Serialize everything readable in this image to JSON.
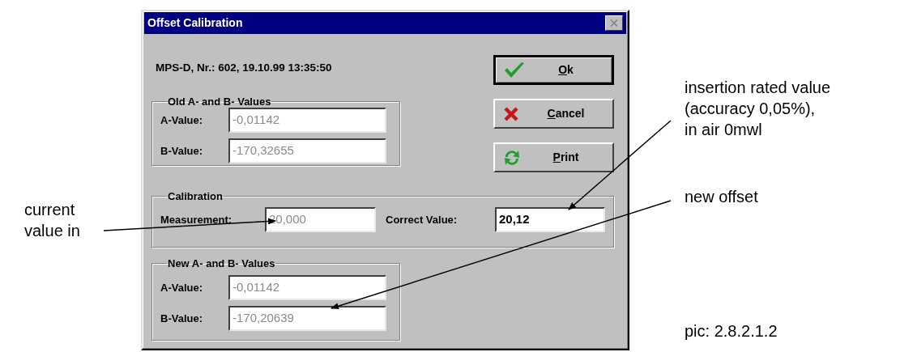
{
  "dialog": {
    "title": "Offset Calibration",
    "header": "MPS-D, Nr.: 602, 19.10.99 13:35:50",
    "groups": [
      {
        "title": "Old A- and B- Values",
        "fields": [
          {
            "label": "A-Value:",
            "value": "-0,01142",
            "disabled": true
          },
          {
            "label": "B-Value:",
            "value": "-170,32655",
            "disabled": true
          }
        ]
      },
      {
        "title": "Calibration",
        "fields": [
          {
            "label": "Measurement:",
            "value": "20,000",
            "disabled": true
          },
          {
            "label": "Correct Value:",
            "value": "20,12",
            "disabled": false
          }
        ]
      },
      {
        "title": "New A- and B- Values",
        "fields": [
          {
            "label": "A-Value:",
            "value": "-0,01142",
            "disabled": true
          },
          {
            "label": "B-Value:",
            "value": "-170,20639",
            "disabled": true
          }
        ]
      }
    ],
    "buttons": [
      {
        "label": "Ok",
        "kind": "check",
        "default": true
      },
      {
        "label": "Cancel",
        "kind": "cross",
        "default": false
      },
      {
        "label": "Print",
        "kind": "refresh",
        "default": false
      }
    ]
  },
  "annotations": [
    {
      "lines": [
        "current",
        "value in"
      ]
    },
    {
      "lines": [
        "insertion rated value",
        "(accuracy 0,05%),",
        "in air 0mwl"
      ]
    },
    {
      "lines": [
        "new offset"
      ]
    }
  ],
  "caption": "pic: 2.8.2.1.2"
}
